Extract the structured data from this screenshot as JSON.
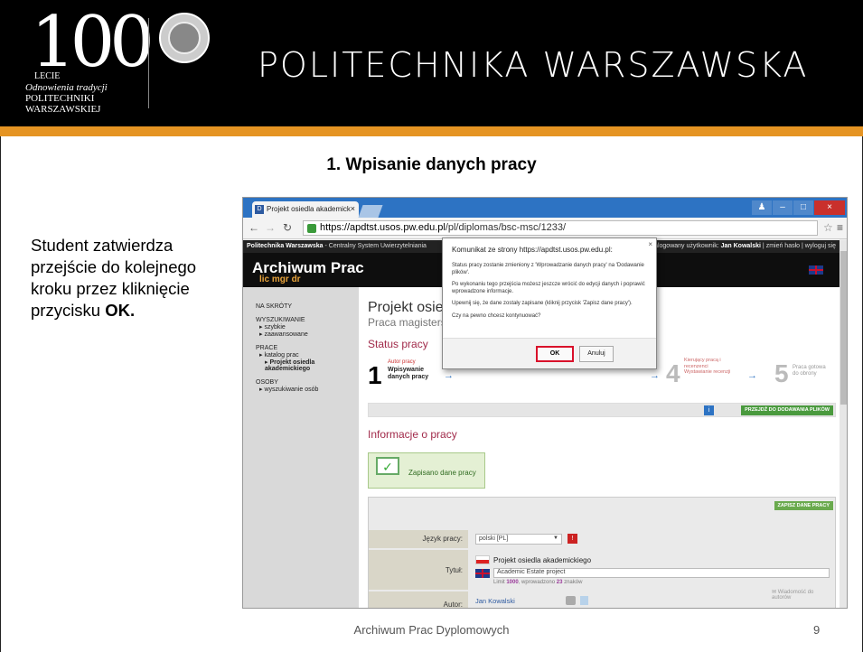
{
  "header": {
    "logo_number": "100",
    "logo_lecie": "LECIE",
    "logo_odnowienia": "Odnowienia tradycji",
    "logo_politechniki": "POLITECHNIKI",
    "logo_warszawskiej": "WARSZAWSKIEJ",
    "title": "POLITECHNIKA WARSZAWSKA"
  },
  "slide": {
    "title": "1. Wpisanie danych pracy",
    "desc_plain": "Student zatwierdza przejście do kolejnego kroku przez kliknięcie przycisku ",
    "desc_bold": "OK.",
    "footer": "Archiwum Prac Dyplomowych",
    "page_number": "9"
  },
  "browser": {
    "tab_title": "Projekt osiedla akademick",
    "tab_close": "×",
    "url_host": "https://apdtst.usos.pw.edu.pl",
    "url_path": "/pl/diplomas/bsc-msc/1233/",
    "win_min": "–",
    "win_max": "□",
    "win_close": "×"
  },
  "site": {
    "topstrip_brand": "Politechnika Warszawska",
    "topstrip_sub": " - Centralny System Uwierzytelniania",
    "topstrip_user_prefix": "Zalogowany użytkownik: ",
    "topstrip_user": "Jan Kowalski",
    "topstrip_links": " | zmień hasło | wyloguj się",
    "app_title": "Archiwum Prac",
    "app_sub": "lic mgr dr"
  },
  "sidebar": {
    "shortcuts": "NA SKRÓTY",
    "search": "WYSZUKIWANIE",
    "search_simple": "szybkie",
    "search_adv": "zaawansowane",
    "theses": "PRACE",
    "catalog": "katalog prac",
    "project": "Projekt osiedla akademickiego",
    "people": "OSOBY",
    "find_people": "wyszukiwanie osób"
  },
  "main": {
    "page_title": "Projekt osied",
    "page_sub": "Praca magisters",
    "status_heading": "Status pracy",
    "step1_num": "1",
    "step1_role": "Autor pracy",
    "step1_label": "Wpisywanie danych pracy",
    "step4_num": "4",
    "step4_label": "Kierujący pracą i recenzenci Wystawianie recenzji",
    "step5_num": "5",
    "step5_label": "Praca gotowa do obrony",
    "go_files": "PRZEJDŹ DO DODAWANIA PLIKÓW",
    "info_heading": "Informacje o pracy",
    "saved_msg": "Zapisano dane pracy",
    "save_btn": "ZAPISZ DANE PRACY",
    "lang_label": "Język pracy:",
    "lang_value": "polski [PL]",
    "title_label": "Tytuł:",
    "title_pl": "Projekt osiedla akademickiego",
    "title_en": "Academic Estate project",
    "limit_pre": "Limit ",
    "limit_max": "1000",
    "limit_mid": ", wprowadzono ",
    "limit_used": "23",
    "limit_post": " znaków",
    "author_label": "Autor:",
    "author_name": "Jan Kowalski",
    "msg_authors": "Wiadomość do autorów"
  },
  "dialog": {
    "title": "Komunikat ze strony https://apdtst.usos.pw.edu.pl:",
    "close": "×",
    "p1": "Status pracy zostanie zmieniony z 'Wprowadzanie danych pracy' na 'Dodawanie plików'.",
    "p2": "Po wykonaniu tego przejścia możesz jeszcze wrócić do edycji danych i poprawić wprowadzone informacje.",
    "p3": "Upewnij się, że dane zostały zapisane (kliknij przycisk 'Zapisz dane pracy').",
    "p4": "Czy na pewno chcesz kontynuować?",
    "ok": "OK",
    "cancel": "Anuluj"
  },
  "colors": {
    "header_bg": "#000000",
    "header_accent": "#e59423",
    "ok_highlight": "#d9102a"
  }
}
